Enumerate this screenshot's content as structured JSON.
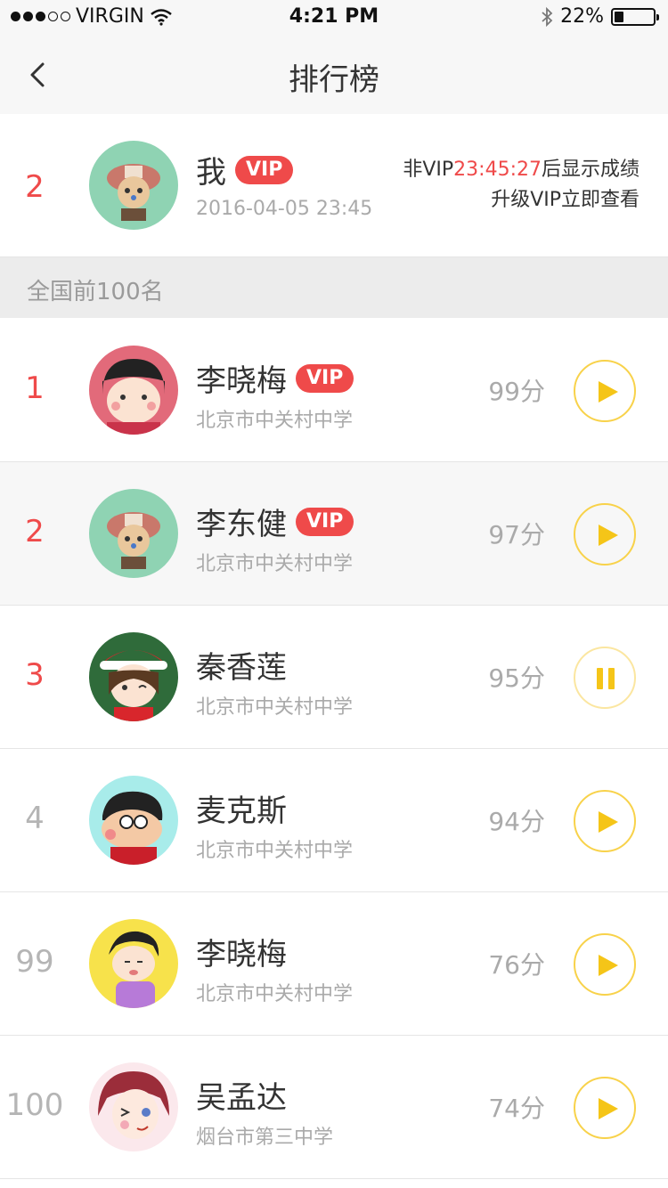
{
  "status_bar": {
    "carrier": "VIRGIN",
    "time": "4:21 PM",
    "battery": "22%"
  },
  "nav": {
    "title": "排行榜"
  },
  "me": {
    "rank": "2",
    "name": "我",
    "vip": "VIP",
    "date": "2016-04-05 23:45",
    "notice_prefix": "非VIP",
    "countdown": "23:45:27",
    "notice_suffix": "后显示成绩",
    "upgrade": "升级VIP立即查看"
  },
  "section": {
    "title": "全国前100名"
  },
  "rows": [
    {
      "rank": "1",
      "name": "李晓梅",
      "vip": "VIP",
      "school": "北京市中关村中学",
      "score": "99分",
      "state": "play"
    },
    {
      "rank": "2",
      "name": "李东健",
      "vip": "VIP",
      "school": "北京市中关村中学",
      "score": "97分",
      "state": "play"
    },
    {
      "rank": "3",
      "name": "秦香莲",
      "school": "北京市中关村中学",
      "score": "95分",
      "state": "pause"
    },
    {
      "rank": "4",
      "name": "麦克斯",
      "school": "北京市中关村中学",
      "score": "94分",
      "state": "play"
    },
    {
      "rank": "99",
      "name": "李晓梅",
      "school": "北京市中关村中学",
      "score": "76分",
      "state": "play"
    },
    {
      "rank": "100",
      "name": "吴孟达",
      "school": "烟台市第三中学",
      "score": "74分",
      "state": "play"
    }
  ],
  "colors": {
    "accent_red": "#ef4a4a",
    "play_yellow": "#f5c518",
    "muted": "#aaaaaa"
  },
  "icons": {
    "back": "chevron-left-icon",
    "play": "play-icon",
    "pause": "pause-icon",
    "wifi": "wifi-icon",
    "bluetooth": "bluetooth-icon"
  }
}
